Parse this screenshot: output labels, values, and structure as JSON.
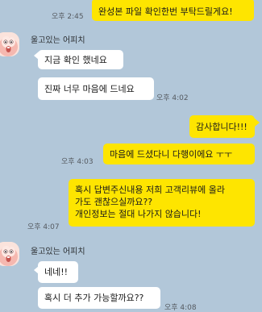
{
  "colors": {
    "background": "#b2c7d9",
    "my_bubble": "#fee500",
    "their_bubble": "#ffffff"
  },
  "icons": {
    "avatar": "pink-character-face-icon"
  },
  "sender_name": "울고있는 어피치",
  "messages": {
    "m1": {
      "text": "완성본 파일 확인한번 부탁드릴게요!",
      "time": "오후 2:45"
    },
    "m2": {
      "text": "지금 확인 했네요"
    },
    "m3": {
      "text": "진짜 너무 마음에 드네요",
      "time": "오후 4:02"
    },
    "m4": {
      "text": "감사합니다!!!"
    },
    "m5": {
      "text": "마음에 드셨다니 다행이에요 ㅜㅜ",
      "time": "오후 4:03"
    },
    "m6": {
      "lines": [
        "혹시 답변주신내용 저희 고객리뷰에 올라",
        "가도 괜찮으실까요??",
        "개인정보는 절대 나가지 않습니다!"
      ],
      "time": "오후 4:07"
    },
    "m7": {
      "text": "네네!!"
    },
    "m8": {
      "text": "혹시 더 추가 가능할까요??",
      "time": "오후 4:08"
    }
  }
}
